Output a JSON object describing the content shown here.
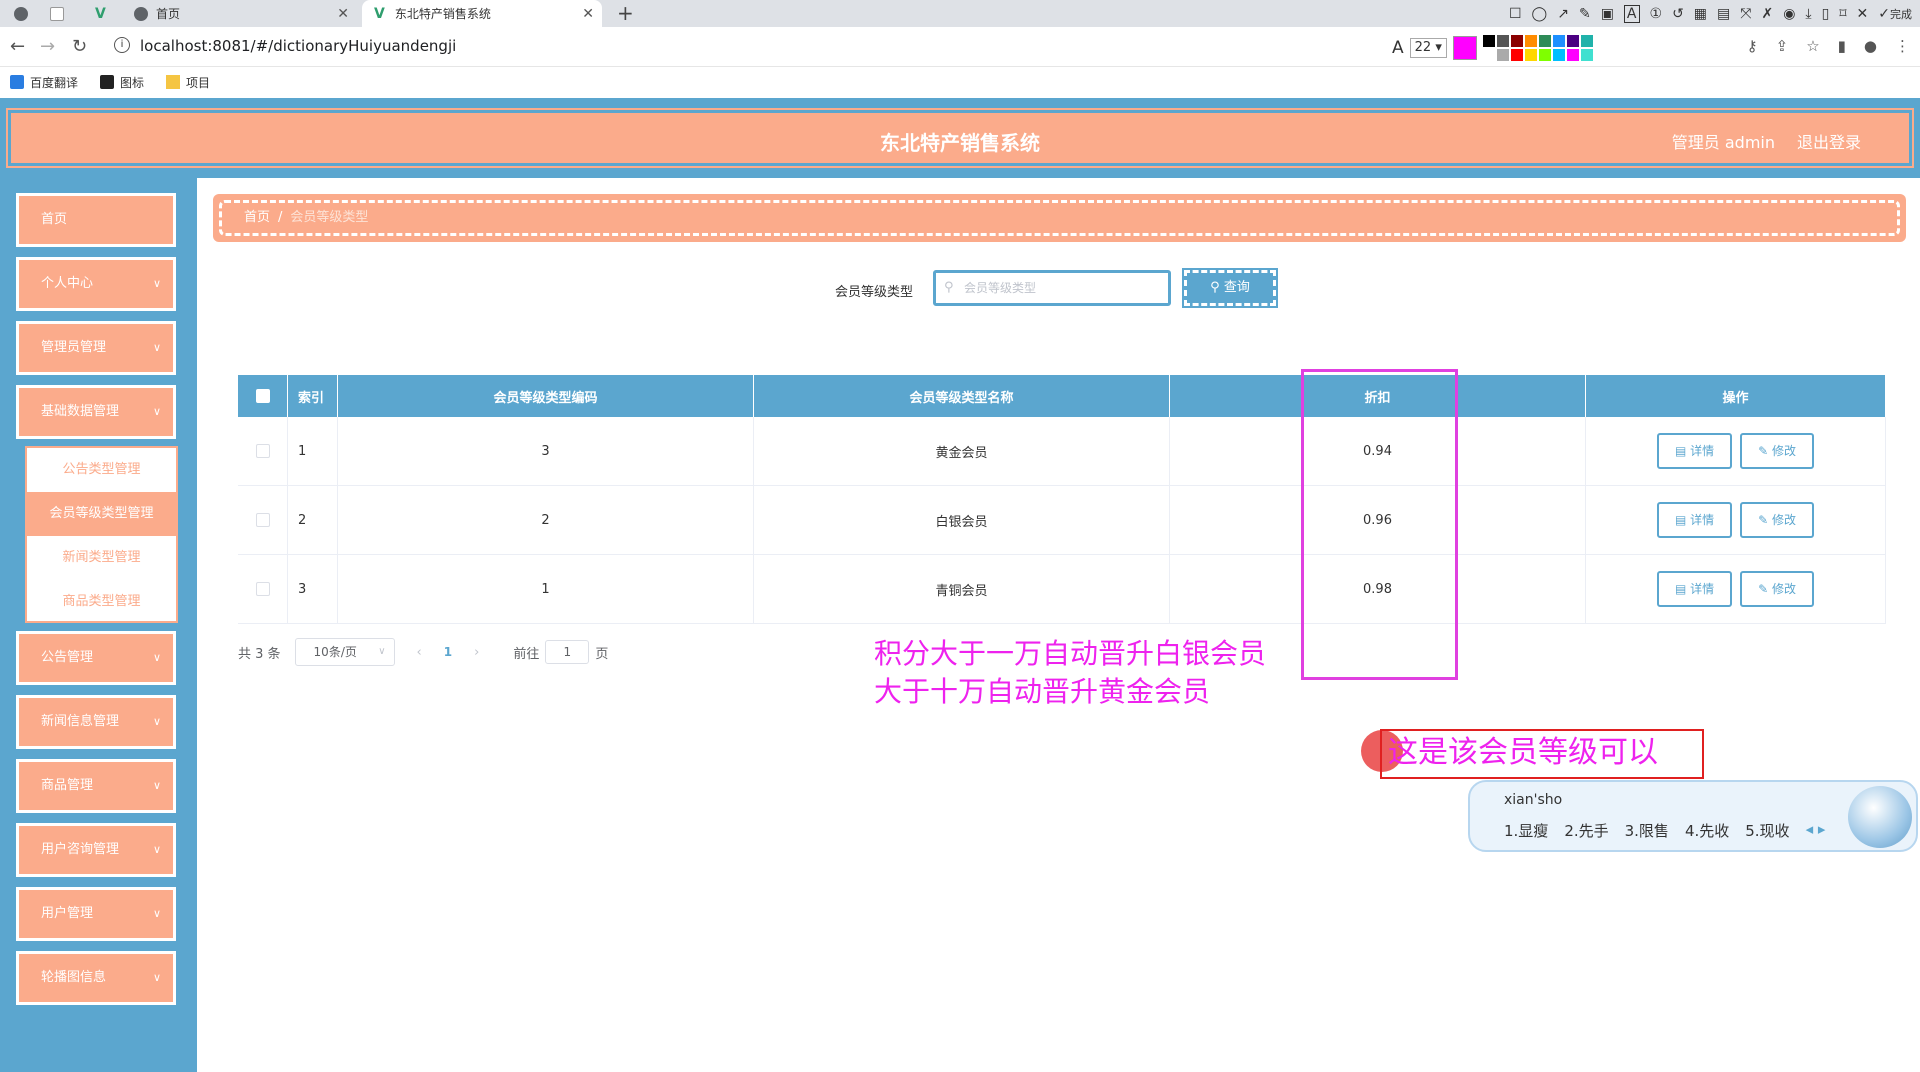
{
  "browser": {
    "tabs": [
      {
        "label": ""
      },
      {
        "label": ""
      },
      {
        "label": ""
      },
      {
        "label": "首页"
      },
      {
        "label": "东北特产销售系统"
      }
    ],
    "url_text": "localhost:8081/#/dictionaryHuiyuandengji",
    "font_size": "22",
    "annotation_color": "#ff00ff",
    "palette": [
      "#000000",
      "#555555",
      "#8b0000",
      "#ff8c00",
      "#2e8b57",
      "#1e90ff",
      "#4b0082",
      "#20b2aa",
      "#ffffff",
      "#aaaaaa",
      "#ff0000",
      "#ffd700",
      "#7fff00",
      "#00bfff",
      "#ff00ff",
      "#40e0d0"
    ],
    "done_label": "完成",
    "bookmarks": [
      {
        "label": "百度翻译",
        "icon": "translate-icon"
      },
      {
        "label": "图标",
        "icon": "image-icon"
      },
      {
        "label": "项目",
        "icon": "folder-icon"
      }
    ]
  },
  "app": {
    "title": "东北特产销售系统",
    "user_label": "管理员 admin",
    "logout_label": "退出登录",
    "colors": {
      "primary": "#5ba6cf",
      "accent": "#fbab8b"
    }
  },
  "sidebar": {
    "items": [
      {
        "label": "首页",
        "has_children": false
      },
      {
        "label": "个人中心",
        "has_children": true
      },
      {
        "label": "管理员管理",
        "has_children": true
      },
      {
        "label": "基础数据管理",
        "has_children": true
      },
      {
        "label": "公告管理",
        "has_children": true
      },
      {
        "label": "新闻信息管理",
        "has_children": true
      },
      {
        "label": "商品管理",
        "has_children": true
      },
      {
        "label": "用户咨询管理",
        "has_children": true
      },
      {
        "label": "用户管理",
        "has_children": true
      },
      {
        "label": "轮播图信息",
        "has_children": true
      }
    ],
    "submenu": [
      {
        "label": "公告类型管理",
        "active": false
      },
      {
        "label": "会员等级类型管理",
        "active": true
      },
      {
        "label": "新闻类型管理",
        "active": false
      },
      {
        "label": "商品类型管理",
        "active": false
      }
    ]
  },
  "breadcrumb": {
    "home": "首页",
    "separator": "/",
    "current": "会员等级类型"
  },
  "search": {
    "label": "会员等级类型",
    "placeholder": "会员等级类型",
    "value": "",
    "button_label": "查询"
  },
  "table": {
    "headers": [
      "索引",
      "会员等级类型编码",
      "会员等级类型名称",
      "折扣",
      "操作"
    ],
    "rows": [
      {
        "index": "1",
        "code": "3",
        "name": "黄金会员",
        "discount": "0.94"
      },
      {
        "index": "2",
        "code": "2",
        "name": "白银会员",
        "discount": "0.96"
      },
      {
        "index": "3",
        "code": "1",
        "name": "青铜会员",
        "discount": "0.98"
      }
    ],
    "actions": {
      "detail": "详情",
      "edit": "修改"
    }
  },
  "pagination": {
    "total_text": "共 3 条",
    "page_size": "10条/页",
    "current_page": "1",
    "goto_prefix": "前往",
    "goto_value": "1",
    "goto_suffix": "页"
  },
  "annotations": {
    "note_line1": "积分大于一万自动晋升白银会员",
    "note_line2": "大于十万自动晋升黄金会员",
    "typing_text": "这是该会员等级可以",
    "ime": {
      "pinyin": "xian'sho",
      "candidates": [
        "1.显瘦",
        "2.先手",
        "3.限售",
        "4.先收",
        "5.现收"
      ]
    }
  }
}
